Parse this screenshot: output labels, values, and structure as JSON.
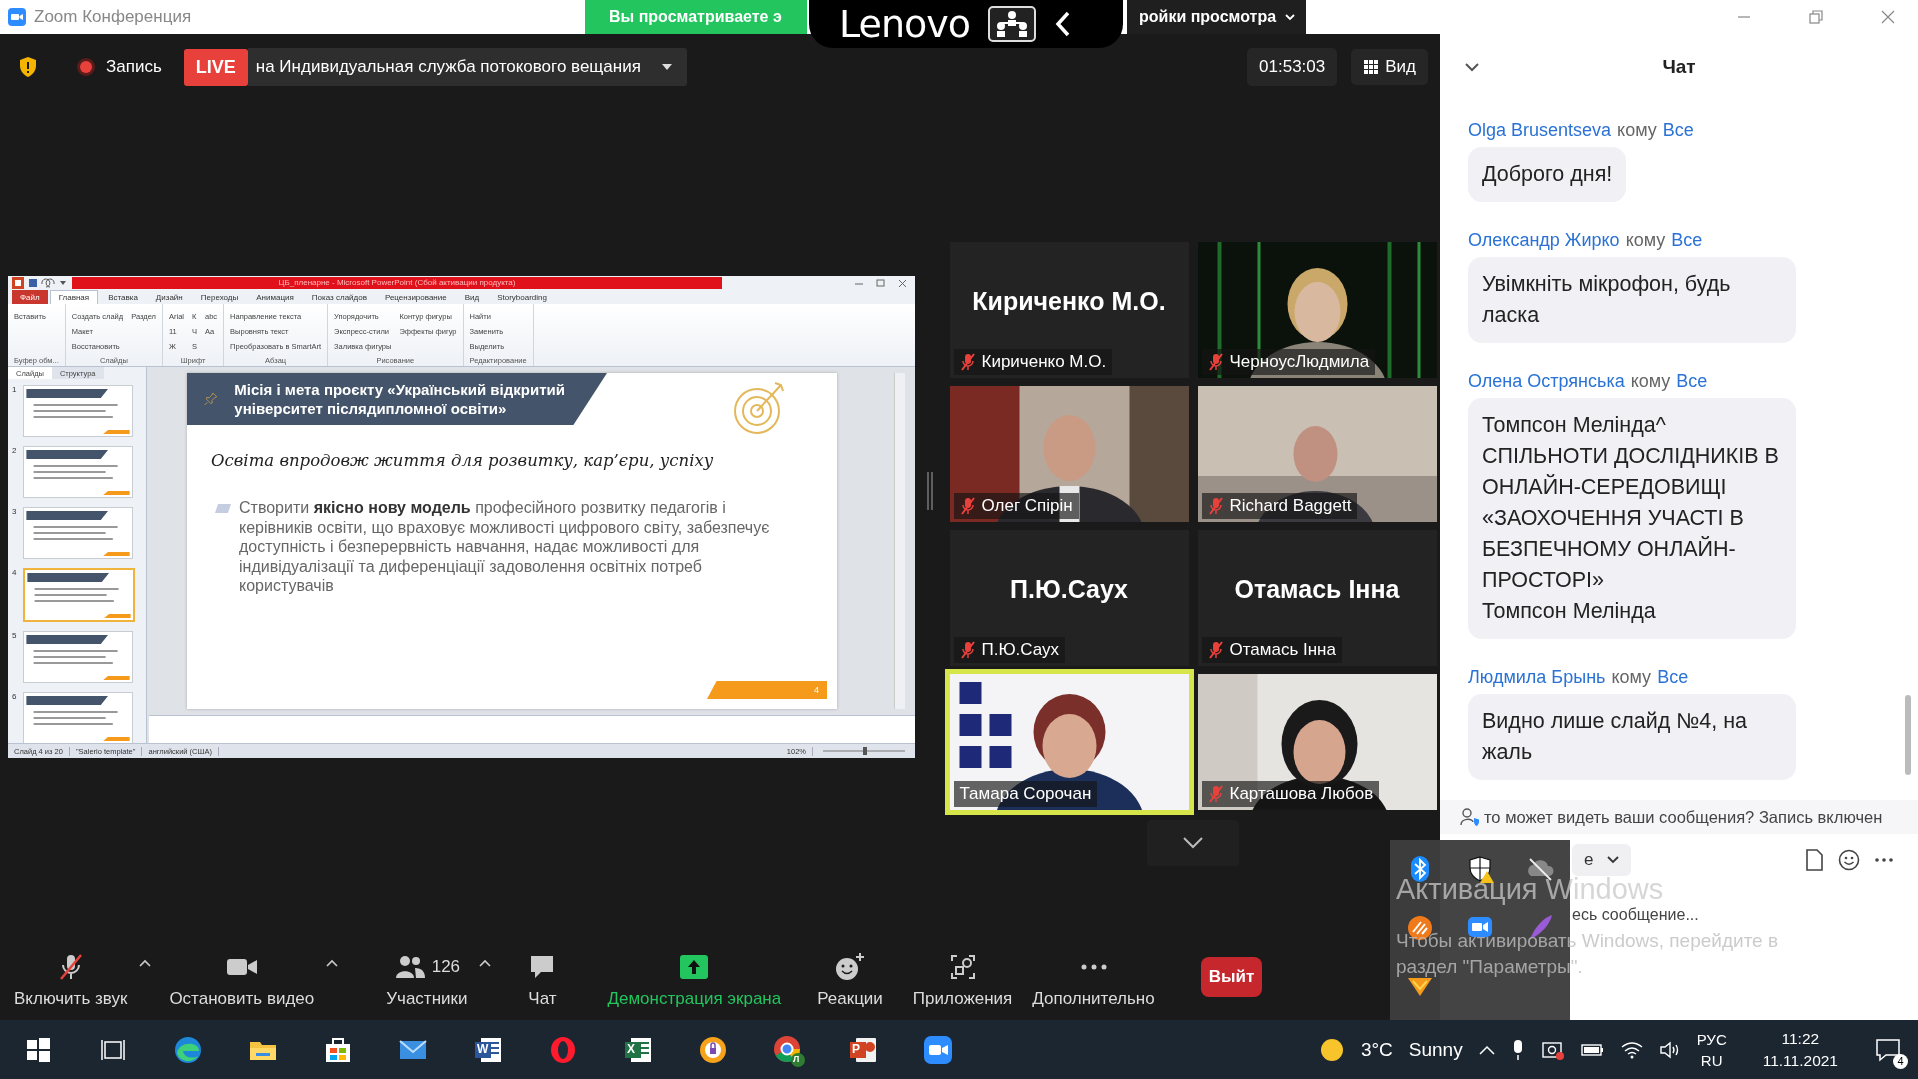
{
  "window": {
    "title": "Zoom Конференция"
  },
  "view_banner": {
    "left_text": "Вы просматриваете э",
    "right_text": "ройки просмотра"
  },
  "overlay": {
    "brand": "Lenovo"
  },
  "meeting_bar": {
    "record_label": "Запись",
    "live_badge": "LIVE",
    "stream_target": "на Индивидуальная служба потокового вещания",
    "timer": "01:53:03",
    "view_label": "Вид"
  },
  "presentation": {
    "title": "ЦБ_пленарне - Microsoft PowerPoint (Сбой активации продукта)",
    "tabs": [
      {
        "label": "Файл",
        "kind": "file",
        "selected": false
      },
      {
        "label": "Главная",
        "kind": "tab",
        "selected": true
      },
      {
        "label": "Вставка",
        "kind": "tab",
        "selected": false
      },
      {
        "label": "Дизайн",
        "kind": "tab",
        "selected": false
      },
      {
        "label": "Переходы",
        "kind": "tab",
        "selected": false
      },
      {
        "label": "Анимация",
        "kind": "tab",
        "selected": false
      },
      {
        "label": "Показ слайдов",
        "kind": "tab",
        "selected": false
      },
      {
        "label": "Рецензирование",
        "kind": "tab",
        "selected": false
      },
      {
        "label": "Вид",
        "kind": "tab",
        "selected": false
      },
      {
        "label": "Storyboarding",
        "kind": "tab",
        "selected": false
      }
    ],
    "groups": [
      {
        "label": "Буфер обм...",
        "buttons": [
          "Вставить"
        ]
      },
      {
        "label": "Слайды",
        "buttons": [
          "Создать слайд",
          "Макет",
          "Восстановить",
          "Раздел"
        ]
      },
      {
        "label": "Шрифт",
        "buttons": [
          "Arial",
          "11",
          "Ж",
          "К",
          "Ч",
          "S",
          "abc",
          "Aa"
        ]
      },
      {
        "label": "Абзац",
        "buttons": [
          "Направление текста",
          "Выровнять текст",
          "Преобразовать в SmartArt"
        ]
      },
      {
        "label": "Рисование",
        "buttons": [
          "Упорядочить",
          "Экспресс-стили",
          "Заливка фигуры",
          "Контур фигуры",
          "Эффекты фигур"
        ]
      },
      {
        "label": "Редактирование",
        "buttons": [
          "Найти",
          "Заменить",
          "Выделить"
        ]
      }
    ],
    "panel_tabs": [
      {
        "label": "Слайды",
        "selected": true
      },
      {
        "label": "Структура",
        "selected": false
      }
    ],
    "thumbnails": [
      {
        "number": "1",
        "selected": false
      },
      {
        "number": "2",
        "selected": false
      },
      {
        "number": "3",
        "selected": false
      },
      {
        "number": "4",
        "selected": true
      },
      {
        "number": "5",
        "selected": false
      },
      {
        "number": "6",
        "selected": false
      }
    ],
    "slide": {
      "title": "Місія і мета проєкту «Український відкритий університет післядипломної освіти»",
      "subtitle": "Освіта впродовж життя для розвитку, кар’єри, успіху",
      "body": "Створити **якісно нову модель** професійного розвитку педагогів і керівників освіти, що враховує можливості цифрового світу, забезпечує доступність і безперервність навчання, надає можливості для індивідуалізації та диференціації задоволення освітніх потреб користувачів",
      "page": "4"
    },
    "status": [
      "Слайд 4 из 20",
      "\"Salerio template\"",
      "английский (США)"
    ],
    "zoom": "102%"
  },
  "tiles": [
    {
      "kind": "name",
      "display_name": "Кириченко М.О.",
      "name": "Кириченко М.О.",
      "muted": true,
      "speaking": false
    },
    {
      "kind": "video",
      "name": "ЧерноусЛюдмила",
      "muted": true,
      "speaking": false
    },
    {
      "kind": "video",
      "name": "Олег Спірін",
      "muted": true,
      "speaking": false
    },
    {
      "kind": "video",
      "name": "Richard Baggett",
      "muted": true,
      "speaking": false
    },
    {
      "kind": "name",
      "display_name": "П.Ю.Саух",
      "name": "П.Ю.Саух",
      "muted": true,
      "speaking": false
    },
    {
      "kind": "name",
      "display_name": "Отамась Інна",
      "name": "Отамась Інна",
      "muted": true,
      "speaking": false
    },
    {
      "kind": "video",
      "name": "Тамара Сорочан",
      "muted": false,
      "speaking": true
    },
    {
      "kind": "video",
      "name": "Карташова Любов",
      "muted": true,
      "speaking": false
    }
  ],
  "toolbar": [
    {
      "kind": "mic",
      "label": "Включить звук",
      "caret": true
    },
    {
      "kind": "video",
      "label": "Остановить видео",
      "caret": true
    },
    {
      "kind": "participants",
      "label": "Участники",
      "count": "126",
      "caret": true
    },
    {
      "kind": "chat",
      "label": "Чат",
      "caret": false
    },
    {
      "kind": "share",
      "label": "Демонстрация экрана",
      "caret": false
    },
    {
      "kind": "reactions",
      "label": "Реакции",
      "caret": false
    },
    {
      "kind": "apps",
      "label": "Приложения",
      "caret": false
    },
    {
      "kind": "more",
      "label": "Дополнительно",
      "caret": false
    }
  ],
  "leave_button": "Выйт",
  "chat": {
    "title": "Чат",
    "messages": [
      {
        "sender": "Olga Brusentseva",
        "to_word": "кому",
        "recipient": "Все",
        "text": "Доброго дня!"
      },
      {
        "sender": "Олександр Жирко",
        "to_word": "кому",
        "recipient": "Все",
        "text": "Увімкніть мікрофон, будь ласка"
      },
      {
        "sender": "Олена Острянська",
        "to_word": "кому",
        "recipient": "Все",
        "text": "Томпсон  Мелінда^\nСПІЛЬНОТИ ДОСЛІДНИКІВ В ОНЛАЙН-СЕРЕДОВИЩІ «ЗАОХОЧЕННЯ УЧАСТІ В БЕЗПЕЧНОМУ ОНЛАЙН-ПРОСТОРІ»\nТомпсон  Мелінда"
      },
      {
        "sender": "Людмила Брынь",
        "to_word": "кому",
        "recipient": "Все",
        "text": "Видно лише слайд №4, на жаль"
      }
    ],
    "privacy_note": "то может видеть ваши сообщения? Запись включен",
    "recipient": "е",
    "placeholder": "есь сообщение..."
  },
  "activation": {
    "title": "Активация Windows",
    "lines": [
      "Чтобы активировать Windows, перейдите в",
      "раздел \"Параметры\"."
    ]
  },
  "tray_popup": [
    {
      "kind": "bluetooth"
    },
    {
      "kind": "shield"
    },
    {
      "kind": "cloud"
    },
    {
      "kind": "orange"
    },
    {
      "kind": "zoom"
    },
    {
      "kind": "feather"
    },
    {
      "kind": "wave"
    }
  ],
  "taskbar": {
    "apps": [
      {
        "kind": "start"
      },
      {
        "kind": "taskview"
      },
      {
        "kind": "edge"
      },
      {
        "kind": "explorer"
      },
      {
        "kind": "store"
      },
      {
        "kind": "mail"
      },
      {
        "kind": "word",
        "glyph": "W"
      },
      {
        "kind": "opera"
      },
      {
        "kind": "excel",
        "glyph": "X"
      },
      {
        "kind": "vpn"
      },
      {
        "kind": "chrome",
        "glyph": "Л"
      },
      {
        "kind": "powerpoint",
        "glyph": "P"
      },
      {
        "kind": "zoom"
      }
    ],
    "temperature": "3°C",
    "weather": "Sunny",
    "lang_top": "РУС",
    "lang_bottom": "RU",
    "time": "11:22",
    "date": "11.11.2021",
    "notifications": "4"
  }
}
